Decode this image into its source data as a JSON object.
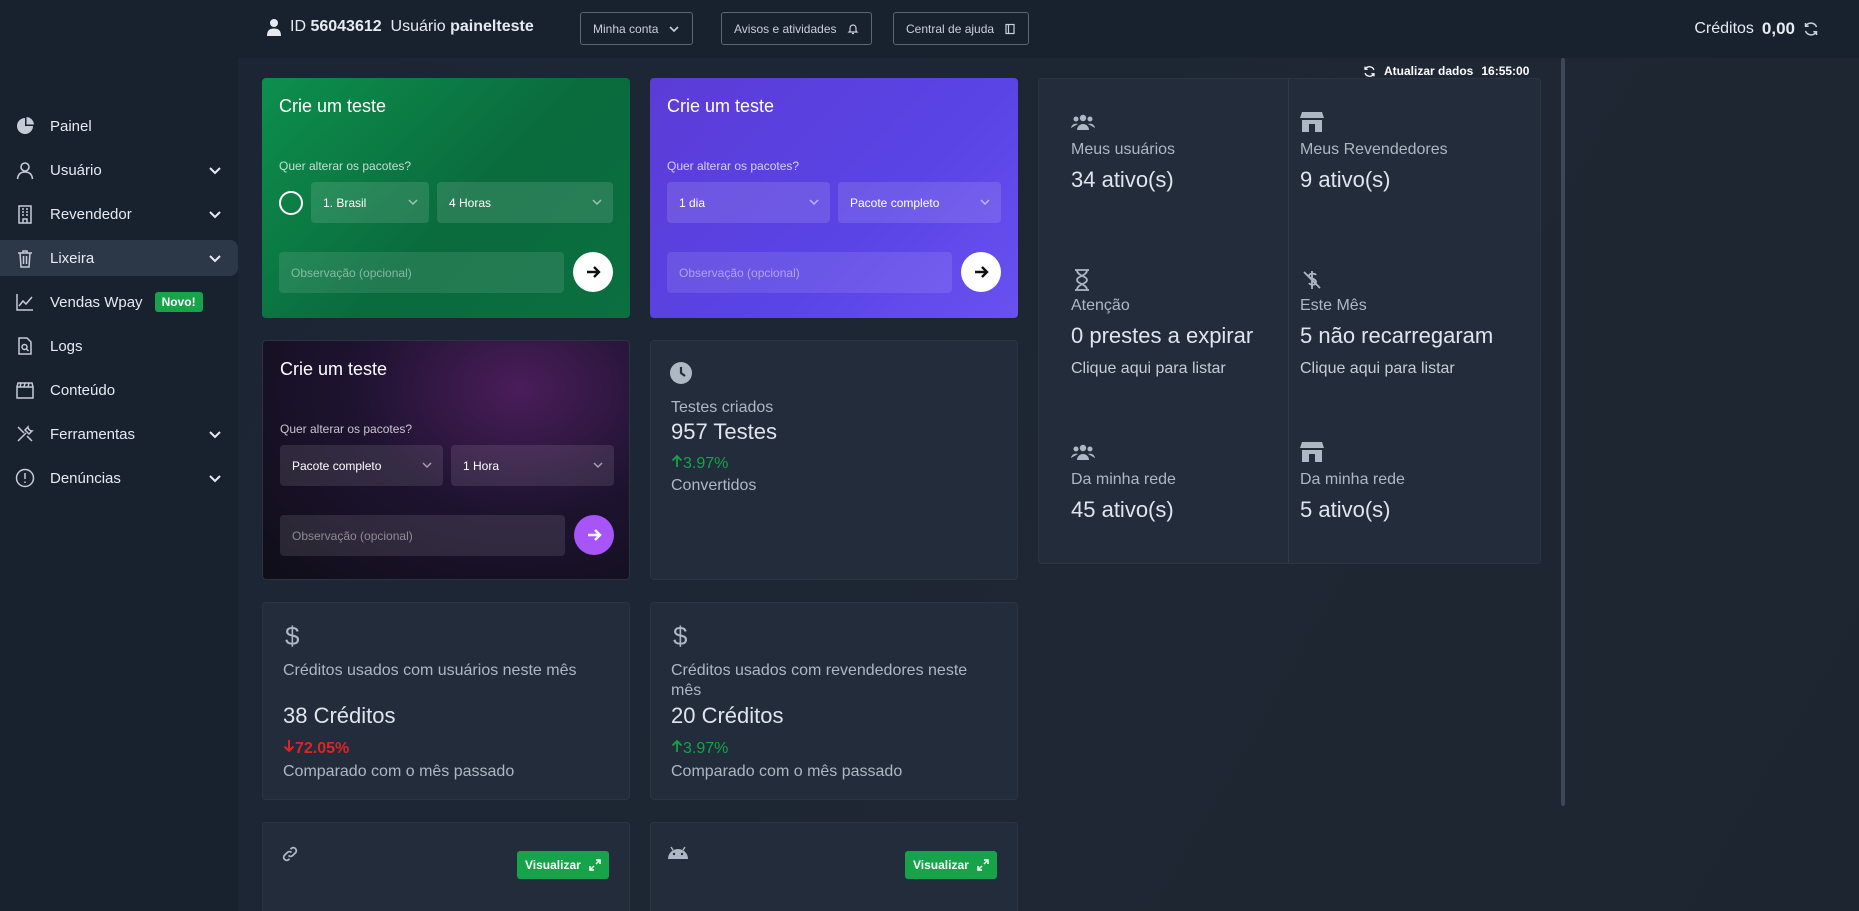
{
  "topbar": {
    "id_label": "ID",
    "id_value": "56043612",
    "user_label": "Usuário",
    "user_value": "painelteste",
    "btn_account": "Minha conta",
    "btn_notices": "Avisos e atividades",
    "btn_help": "Central de ajuda",
    "credits_label": "Créditos",
    "credits_value": "0,00"
  },
  "sidebar": {
    "items": [
      {
        "label": "Painel",
        "icon": "pie-chart-icon",
        "chevron": false
      },
      {
        "label": "Usuário",
        "icon": "user-icon",
        "chevron": true
      },
      {
        "label": "Revendedor",
        "icon": "building-icon",
        "chevron": true
      },
      {
        "label": "Lixeira",
        "icon": "trash-icon",
        "chevron": true,
        "active": true
      },
      {
        "label": "Vendas Wpay",
        "icon": "line-chart-icon",
        "chevron": false,
        "badge": "Novo!"
      },
      {
        "label": "Logs",
        "icon": "file-search-icon",
        "chevron": false
      },
      {
        "label": "Conteúdo",
        "icon": "clapperboard-icon",
        "chevron": false
      },
      {
        "label": "Ferramentas",
        "icon": "tools-icon",
        "chevron": true
      },
      {
        "label": "Denúncias",
        "icon": "alert-circle-icon",
        "chevron": true
      }
    ]
  },
  "refresh": {
    "label": "Atualizar dados",
    "time": "16:55:00"
  },
  "test_cards": [
    {
      "title": "Crie um teste",
      "question": "Quer alterar os pacotes?",
      "select1": "1. Brasil",
      "select2": "4 Horas",
      "placeholder": "Observação (opcional)"
    },
    {
      "title": "Crie um teste",
      "question": "Quer alterar os pacotes?",
      "select1": "1 dia",
      "select2": "Pacote completo",
      "placeholder": "Observação (opcional)"
    },
    {
      "title": "Crie um teste",
      "question": "Quer alterar os pacotes?",
      "select1": "Pacote completo",
      "select2": "1 Hora",
      "placeholder": "Observação (opcional)"
    }
  ],
  "tests_stat": {
    "label": "Testes criados",
    "value": "957 Testes",
    "trend": "3.97%",
    "sub": "Convertidos"
  },
  "credits_users": {
    "label": "Créditos usados com usuários neste mês",
    "value": "38 Créditos",
    "trend": "72.05%",
    "sub": "Comparado com o mês passado"
  },
  "credits_resellers": {
    "label": "Créditos usados com revendedores neste mês",
    "value": "20 Créditos",
    "trend": "3.97%",
    "sub": "Comparado com o mês passado"
  },
  "bottom": {
    "btn1": "Visualizar",
    "btn2": "Visualizar"
  },
  "right_panel": {
    "my_users_label": "Meus usuários",
    "my_users_value": "34 ativo(s)",
    "my_resellers_label": "Meus Revendedores",
    "my_resellers_value": "9 ativo(s)",
    "attention_label": "Atenção",
    "attention_value": "0 prestes a expirar",
    "attention_link": "Clique aqui para listar",
    "month_label": "Este Mês",
    "month_value": "5 não recarregaram",
    "month_link": "Clique aqui para listar",
    "net_users_label": "Da minha rede",
    "net_users_value": "45 ativo(s)",
    "net_resellers_label": "Da minha rede",
    "net_resellers_value": "5 ativo(s)"
  },
  "colors": {
    "accent_green": "#16a34a",
    "trend_down": "#dc2626",
    "purple_btn": "#a855f7",
    "bg": "#1a2332"
  }
}
